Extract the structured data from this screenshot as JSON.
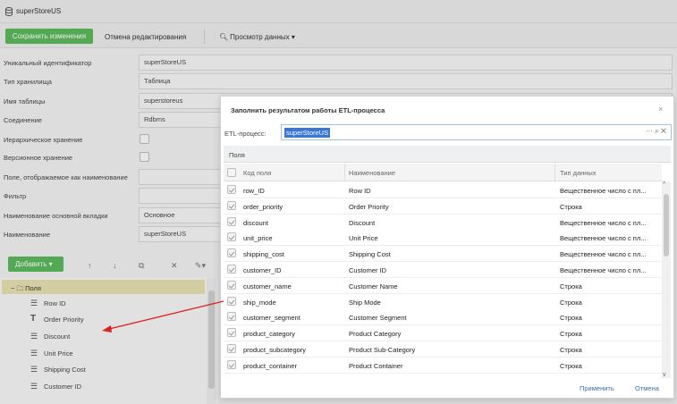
{
  "window": {
    "title": "superStoreUS"
  },
  "toolbar": {
    "save_label": "Сохранить изменения",
    "cancel_edit_label": "Отмена редактирования",
    "preview_label": "Просмотр данных"
  },
  "form": [
    {
      "label": "Уникальный идентификатор",
      "value": "superStoreUS"
    },
    {
      "label": "Тип хранилища",
      "value": "Таблица"
    },
    {
      "label": "Имя таблицы",
      "value": "superstoreus"
    },
    {
      "label": "Соединение",
      "value": "Rdbms"
    },
    {
      "label": "Иерархическое хранение",
      "value": ""
    },
    {
      "label": "Версионное хранение",
      "value": ""
    },
    {
      "label": "Поле, отображаемое как наименование",
      "value": ""
    },
    {
      "label": "Фильтр",
      "value": ""
    },
    {
      "label": "Наименование основной вкладки",
      "value": "Основное"
    },
    {
      "label": "Наименование",
      "value": "superStoreUS"
    }
  ],
  "tree": {
    "add_label": "Добавить",
    "root_label": "Поля",
    "items": [
      {
        "label": "Row ID",
        "icon": "list-icon"
      },
      {
        "label": "Order Priority",
        "icon": "text-icon"
      },
      {
        "label": "Discount",
        "icon": "list-icon"
      },
      {
        "label": "Unit Price",
        "icon": "list-icon"
      },
      {
        "label": "Shipping Cost",
        "icon": "list-icon"
      },
      {
        "label": "Customer ID",
        "icon": "list-icon"
      }
    ]
  },
  "dialog": {
    "title": "Заполнить результатом работы ETL-процесса",
    "etl_label": "ETL-процесс:",
    "etl_value": "superStoreUS",
    "fields_label": "Поля",
    "columns": [
      "Код поля",
      "Наименование",
      "Тип данных"
    ],
    "rows": [
      {
        "code": "row_ID",
        "name": "Row ID",
        "type": "Вещественное число с пл..."
      },
      {
        "code": "order_priority",
        "name": "Order Priority",
        "type": "Строка"
      },
      {
        "code": "discount",
        "name": "Discount",
        "type": "Вещественное число с пл..."
      },
      {
        "code": "unit_price",
        "name": "Unit Price",
        "type": "Вещественное число с пл..."
      },
      {
        "code": "shipping_cost",
        "name": "Shipping Cost",
        "type": "Вещественное число с пл..."
      },
      {
        "code": "customer_ID",
        "name": "Customer ID",
        "type": "Вещественное число с пл..."
      },
      {
        "code": "customer_name",
        "name": "Customer Name",
        "type": "Строка"
      },
      {
        "code": "ship_mode",
        "name": "Ship Mode",
        "type": "Строка"
      },
      {
        "code": "customer_segment",
        "name": "Customer Segment",
        "type": "Строка"
      },
      {
        "code": "product_category",
        "name": "Product Category",
        "type": "Строка"
      },
      {
        "code": "product_subcategory",
        "name": "Product Sub-Category",
        "type": "Строка"
      },
      {
        "code": "product_container",
        "name": "Product Container",
        "type": "Строка"
      }
    ],
    "apply_label": "Применить",
    "cancel_label": "Отмена"
  },
  "colors": {
    "primary_green": "#5cb85c",
    "highlight_blue": "#3a77d5",
    "tree_selected": "#e8dfb0",
    "arrow_red": "#e02020"
  }
}
